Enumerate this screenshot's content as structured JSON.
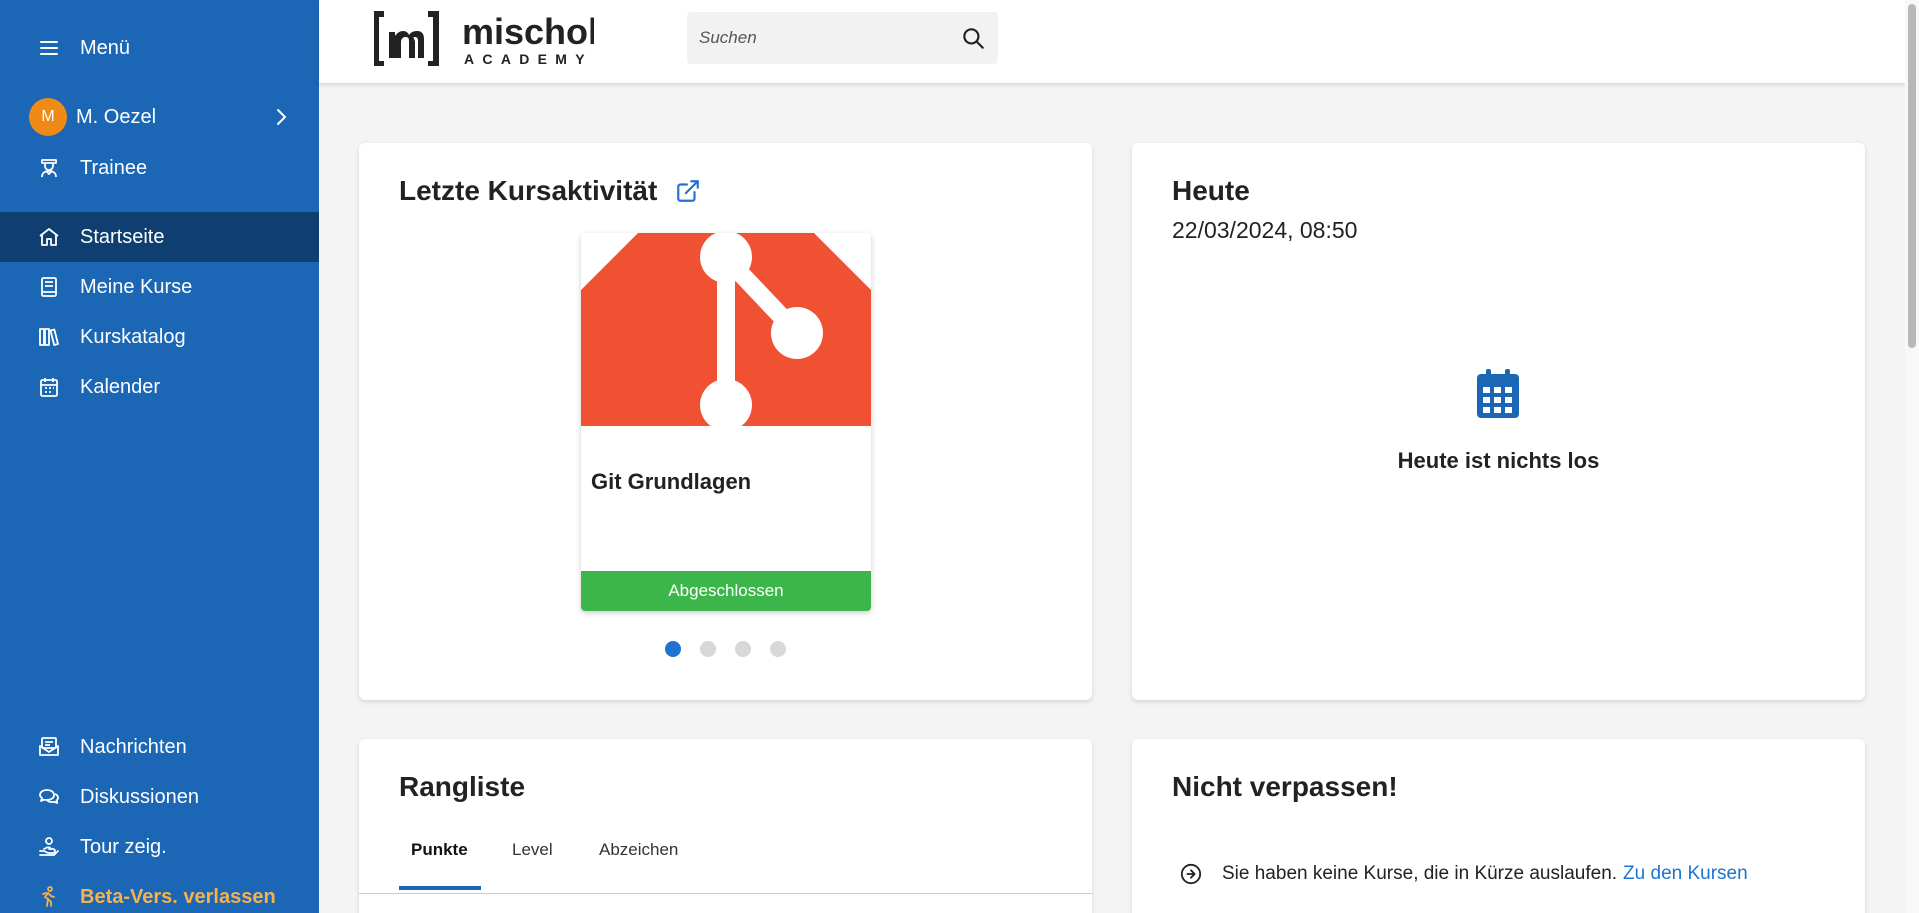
{
  "sidebar": {
    "menu_label": "Menü",
    "user": {
      "initial": "M",
      "name": "M. Oezel"
    },
    "role": "Trainee",
    "nav": [
      {
        "label": "Startseite",
        "icon": "home-icon"
      },
      {
        "label": "Meine Kurse",
        "icon": "book-icon"
      },
      {
        "label": "Kurskatalog",
        "icon": "library-icon"
      },
      {
        "label": "Kalender",
        "icon": "calendar-icon"
      }
    ],
    "bottom": [
      {
        "label": "Nachrichten",
        "icon": "mail-icon"
      },
      {
        "label": "Diskussionen",
        "icon": "chat-icon"
      },
      {
        "label": "Tour zeig.",
        "icon": "hand-icon"
      },
      {
        "label": "Beta-Vers. verlassen",
        "icon": "walk-icon"
      }
    ]
  },
  "header": {
    "logo_word": "mischok",
    "logo_sub": "ACADEMY",
    "search_placeholder": "Suchen"
  },
  "activity": {
    "title": "Letzte Kursaktivität",
    "course": {
      "name": "Git Grundlagen",
      "status": "Abgeschlossen"
    },
    "carousel_count": 4,
    "carousel_active": 0
  },
  "today": {
    "title": "Heute",
    "datetime": "22/03/2024, 08:50",
    "empty_message": "Heute ist nichts los"
  },
  "ranking": {
    "title": "Rangliste",
    "tabs": [
      "Punkte",
      "Level",
      "Abzeichen"
    ],
    "active_tab": 0
  },
  "reminder": {
    "title": "Nicht verpassen!",
    "message": "Sie haben keine Kurse, die in Kürze auslaufen.",
    "link": "Zu den Kursen"
  },
  "colors": {
    "sidebar": "#1b67b5",
    "sidebar_active": "#0f3f70",
    "accent": "#1e74d0",
    "success": "#3cb54a",
    "git_orange": "#f05133",
    "avatar": "#f08a16"
  }
}
